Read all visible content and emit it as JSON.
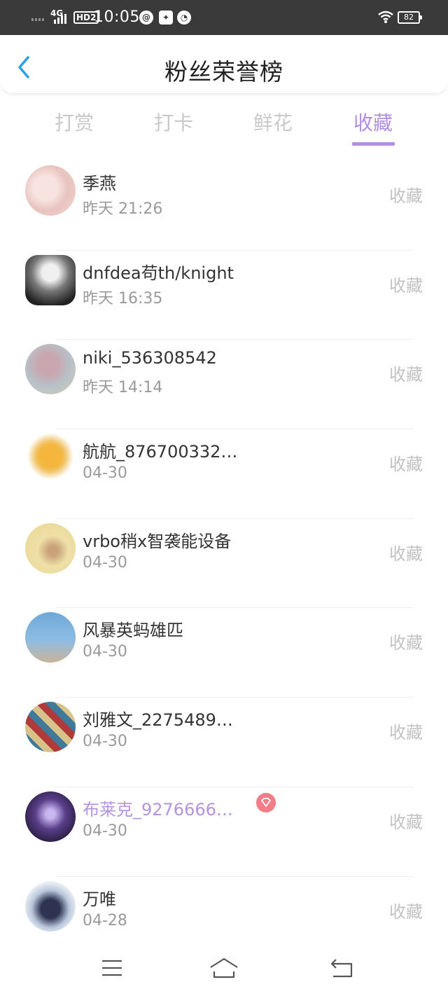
{
  "status_bar": {
    "network": "4G",
    "hd": "HD2",
    "time": "10:05",
    "battery": "82"
  },
  "header": {
    "title": "粉丝荣誉榜",
    "back_icon": "chevron-left-icon"
  },
  "tabs": [
    {
      "label": "打赏",
      "active": false
    },
    {
      "label": "打卡",
      "active": false
    },
    {
      "label": "鲜花",
      "active": false
    },
    {
      "label": "收藏",
      "active": true
    }
  ],
  "fans": [
    {
      "name": "季燕",
      "time": "昨天 21:26",
      "action": "收藏"
    },
    {
      "name": "dnfdea苟th/knight",
      "time": "昨天 16:35",
      "action": "收藏"
    },
    {
      "name": "niki_536308542",
      "time": "昨天 14:14",
      "action": "收藏"
    },
    {
      "name": "航航_876700332…",
      "time": "04-30",
      "action": "收藏"
    },
    {
      "name": "vrbo稍x智袭能设备",
      "time": "04-30",
      "action": "收藏"
    },
    {
      "name": "风暴英蚂雄匹",
      "time": "04-30",
      "action": "收藏"
    },
    {
      "name": "刘雅文_2275489…",
      "time": "04-30",
      "action": "收藏"
    },
    {
      "name": "布莱克_9276666…",
      "time": "04-30",
      "action": "收藏",
      "vip": true
    },
    {
      "name": "万唯",
      "time": "04-28",
      "action": "收藏"
    }
  ],
  "colors": {
    "accent": "#b08ee0",
    "vip_name": "#b693de",
    "vip_badge": "#f27d87",
    "back_icon": "#2ea0e8"
  },
  "navbar": {
    "menu_icon": "menu-icon",
    "home_icon": "home-icon",
    "back_icon": "back-icon"
  }
}
